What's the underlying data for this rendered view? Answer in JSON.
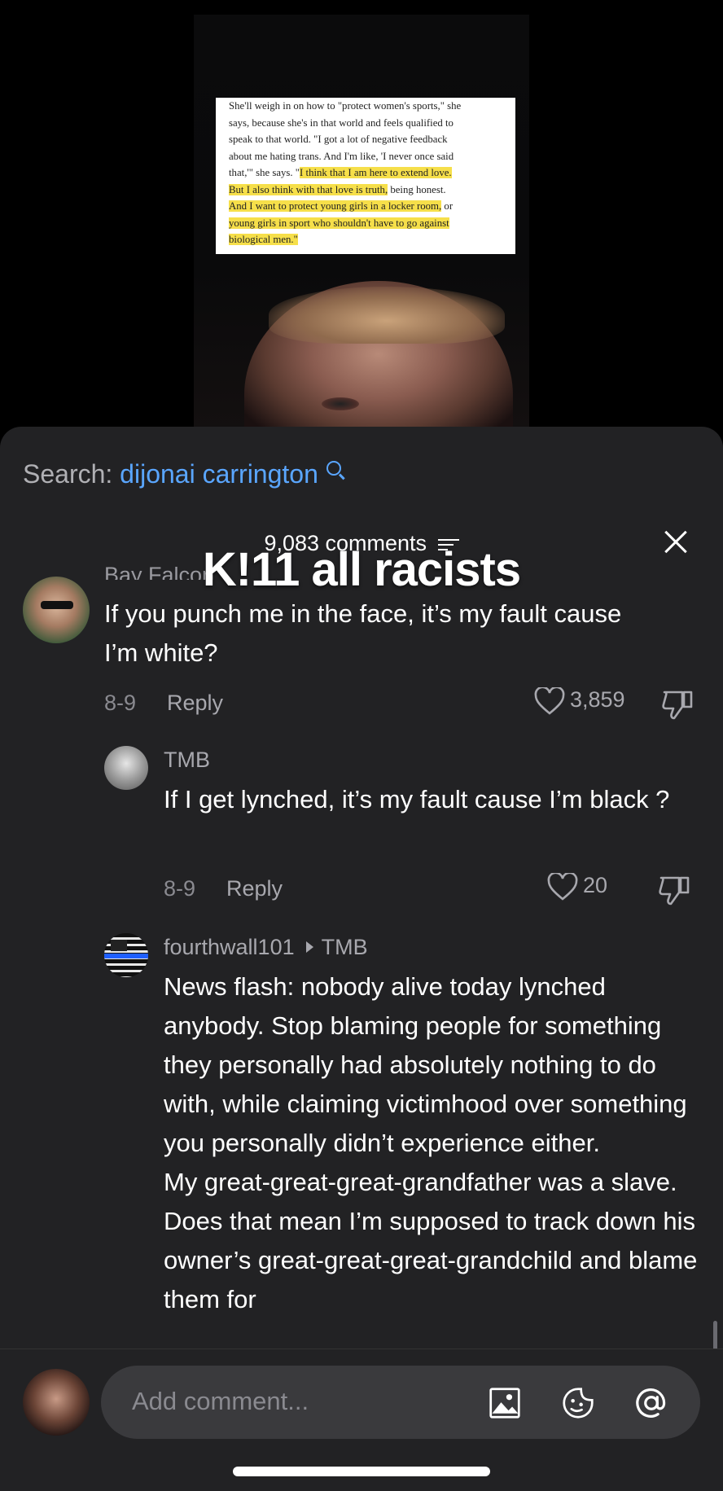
{
  "video": {
    "document_lines": [
      {
        "text": "She'll weigh in on how to \"protect women's sports,\" she",
        "highlight": ""
      },
      {
        "text": "says, because she's in that world and feels qualified to",
        "highlight": ""
      },
      {
        "text": "speak to that world. \"I got a lot of negative feedback",
        "highlight": ""
      },
      {
        "text": "about me hating trans. And I'm like, 'I never once said",
        "highlight": ""
      },
      {
        "text": "that,'\" she says. \"",
        "highlight": "I think that I am here to extend love."
      },
      {
        "text": "",
        "highlight": "But I also think with that love is truth,",
        "after": " being honest."
      },
      {
        "text": "",
        "highlight": "And I want to protect young girls in a locker room,",
        "after": " or"
      },
      {
        "text": "",
        "highlight": "young girls in sport who shouldn't have to go against"
      },
      {
        "text": "",
        "highlight": "biological men.\""
      }
    ]
  },
  "search": {
    "label": "Search:",
    "query": "dijonai carrington"
  },
  "comments_header": {
    "count_text": "9,083 comments"
  },
  "overlay_text": "K!11 all racists",
  "comments": [
    {
      "author": "Bay Falcon",
      "text": "If you punch me in the face, it’s my fault cause I’m white?",
      "date": "8-9",
      "reply_label": "Reply",
      "likes": "3,859"
    },
    {
      "author": "TMB",
      "text": "If I get lynched, it’s my fault cause I’m black ?",
      "date": "8-9",
      "reply_label": "Reply",
      "likes": "20"
    },
    {
      "author": "fourthwall101",
      "reply_to": "TMB",
      "text": "News flash: nobody alive today lynched anybody. Stop blaming people for something they personally had absolutely nothing to do with, while claiming victimhood over something you personally didn’t experience either.\nMy great-great-great-grandfather was a slave. Does that mean I’m supposed to track down his owner’s great-great-great-grandchild and blame them for"
    }
  ],
  "composer": {
    "placeholder": "Add comment..."
  },
  "icons": [
    "search-icon",
    "filter-icon",
    "close-icon",
    "heart-icon",
    "dislike-icon",
    "image-icon",
    "emoji-icon",
    "mention-icon"
  ],
  "colors": {
    "sheet": "#222224",
    "link": "#5aa6ff",
    "highlight": "#f6df4a"
  }
}
